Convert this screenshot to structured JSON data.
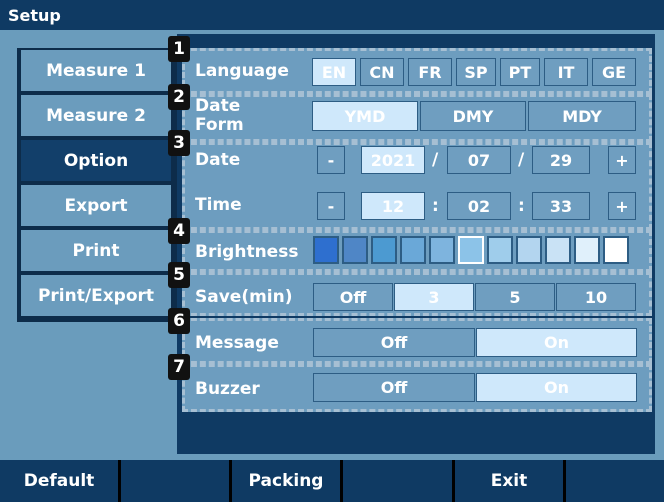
{
  "title": "Setup",
  "menu": [
    "Measure 1",
    "Measure 2",
    "Option",
    "Export",
    "Print",
    "Print/Export"
  ],
  "language": {
    "label": "Language",
    "options": [
      "EN",
      "CN",
      "FR",
      "SP",
      "PT",
      "IT",
      "GE"
    ],
    "selected": "EN"
  },
  "date_form": {
    "label_line1": "Date",
    "label_line2": "Form",
    "options": [
      "YMD",
      "DMY",
      "MDY"
    ],
    "selected": "YMD"
  },
  "date": {
    "label": "Date",
    "minus": "-",
    "plus": "+",
    "year": "2021",
    "month": "07",
    "day": "29",
    "sep": "/"
  },
  "time": {
    "label": "Time",
    "minus": "-",
    "plus": "+",
    "hour": "12",
    "minute": "02",
    "second": "33",
    "sep": ":"
  },
  "brightness": {
    "label": "Brightness",
    "levels": 11,
    "selected_level": 6,
    "colors": [
      "#2e6fcf",
      "#4f86c6",
      "#4c9ad1",
      "#6aa8d8",
      "#7eb4de",
      "#8cc3e8",
      "#9fcdeb",
      "#b3d5ef",
      "#c9e2f5",
      "#e0f0fb",
      "#ffffff"
    ]
  },
  "save": {
    "label": "Save(min)",
    "options": [
      "Off",
      "3",
      "5",
      "10"
    ],
    "selected": "3"
  },
  "message": {
    "label": "Message",
    "options": [
      "Off",
      "On"
    ],
    "selected": "On"
  },
  "buzzer": {
    "label": "Buzzer",
    "options": [
      "Off",
      "On"
    ],
    "selected": "On"
  },
  "badges": [
    "1",
    "2",
    "3",
    "4",
    "5",
    "6",
    "7"
  ],
  "bottom": [
    "Default",
    "",
    "Packing",
    "",
    "Exit",
    ""
  ],
  "colors": {
    "title_bg": "#0f3a63",
    "panel_bg": "#6d9dbf",
    "selected_cell": "#cfe8fb",
    "active_menu": "#123f6a"
  }
}
